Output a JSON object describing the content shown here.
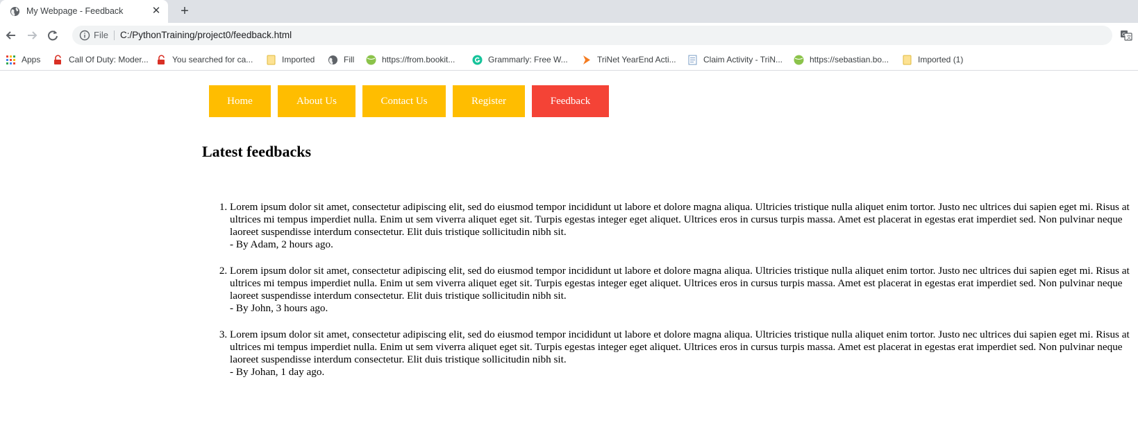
{
  "browser": {
    "tab_title": "My Webpage - Feedback",
    "tab_close": "✕",
    "new_tab": "+",
    "address_chip": "File",
    "url": "C:/PythonTraining/project0/feedback.html"
  },
  "bookmarks": [
    {
      "label": "Apps",
      "icon": "apps-grid-icon"
    },
    {
      "label": "Call Of Duty: Moder...",
      "icon": "lock-red-icon"
    },
    {
      "label": "You searched for ca...",
      "icon": "lock-red-icon"
    },
    {
      "label": "Imported",
      "icon": "folder-icon"
    },
    {
      "label": "Fill",
      "icon": "globe-icon"
    },
    {
      "label": "https://from.bookit...",
      "icon": "green-ball-icon"
    },
    {
      "label": "Grammarly: Free W...",
      "icon": "grammarly-icon"
    },
    {
      "label": "TriNet YearEnd Acti...",
      "icon": "arrow-orange-icon"
    },
    {
      "label": "Claim Activity - TriN...",
      "icon": "document-icon"
    },
    {
      "label": "https://sebastian.bo...",
      "icon": "green-ball-icon"
    },
    {
      "label": "Imported (1)",
      "icon": "folder-icon"
    }
  ],
  "nav": {
    "items": [
      {
        "label": "Home",
        "active": false
      },
      {
        "label": "About Us",
        "active": false
      },
      {
        "label": "Contact Us",
        "active": false
      },
      {
        "label": "Register",
        "active": false
      },
      {
        "label": "Feedback",
        "active": true
      }
    ],
    "colors": {
      "default": "#ffbd00",
      "active": "#f44336"
    }
  },
  "main": {
    "heading": "Latest feedbacks",
    "feedbacks": [
      {
        "text": "Lorem ipsum dolor sit amet, consectetur adipiscing elit, sed do eiusmod tempor incididunt ut labore et dolore magna aliqua. Ultricies tristique nulla aliquet enim tortor. Justo nec ultrices dui sapien eget mi. Risus at ultrices mi tempus imperdiet nulla. Enim ut sem viverra aliquet eget sit. Turpis egestas integer eget aliquet. Ultrices eros in cursus turpis massa. Amet est placerat in egestas erat imperdiet sed. Non pulvinar neque laoreet suspendisse interdum consectetur. Elit duis tristique sollicitudin nibh sit.",
        "byline": "- By Adam, 2 hours ago."
      },
      {
        "text": "Lorem ipsum dolor sit amet, consectetur adipiscing elit, sed do eiusmod tempor incididunt ut labore et dolore magna aliqua. Ultricies tristique nulla aliquet enim tortor. Justo nec ultrices dui sapien eget mi. Risus at ultrices mi tempus imperdiet nulla. Enim ut sem viverra aliquet eget sit. Turpis egestas integer eget aliquet. Ultrices eros in cursus turpis massa. Amet est placerat in egestas erat imperdiet sed. Non pulvinar neque laoreet suspendisse interdum consectetur. Elit duis tristique sollicitudin nibh sit.",
        "byline": "- By John, 3 hours ago."
      },
      {
        "text": "Lorem ipsum dolor sit amet, consectetur adipiscing elit, sed do eiusmod tempor incididunt ut labore et dolore magna aliqua. Ultricies tristique nulla aliquet enim tortor. Justo nec ultrices dui sapien eget mi. Risus at ultrices mi tempus imperdiet nulla. Enim ut sem viverra aliquet eget sit. Turpis egestas integer eget aliquet. Ultrices eros in cursus turpis massa. Amet est placerat in egestas erat imperdiet sed. Non pulvinar neque laoreet suspendisse interdum consectetur. Elit duis tristique sollicitudin nibh sit.",
        "byline": "- By Johan, 1 day ago."
      }
    ]
  }
}
